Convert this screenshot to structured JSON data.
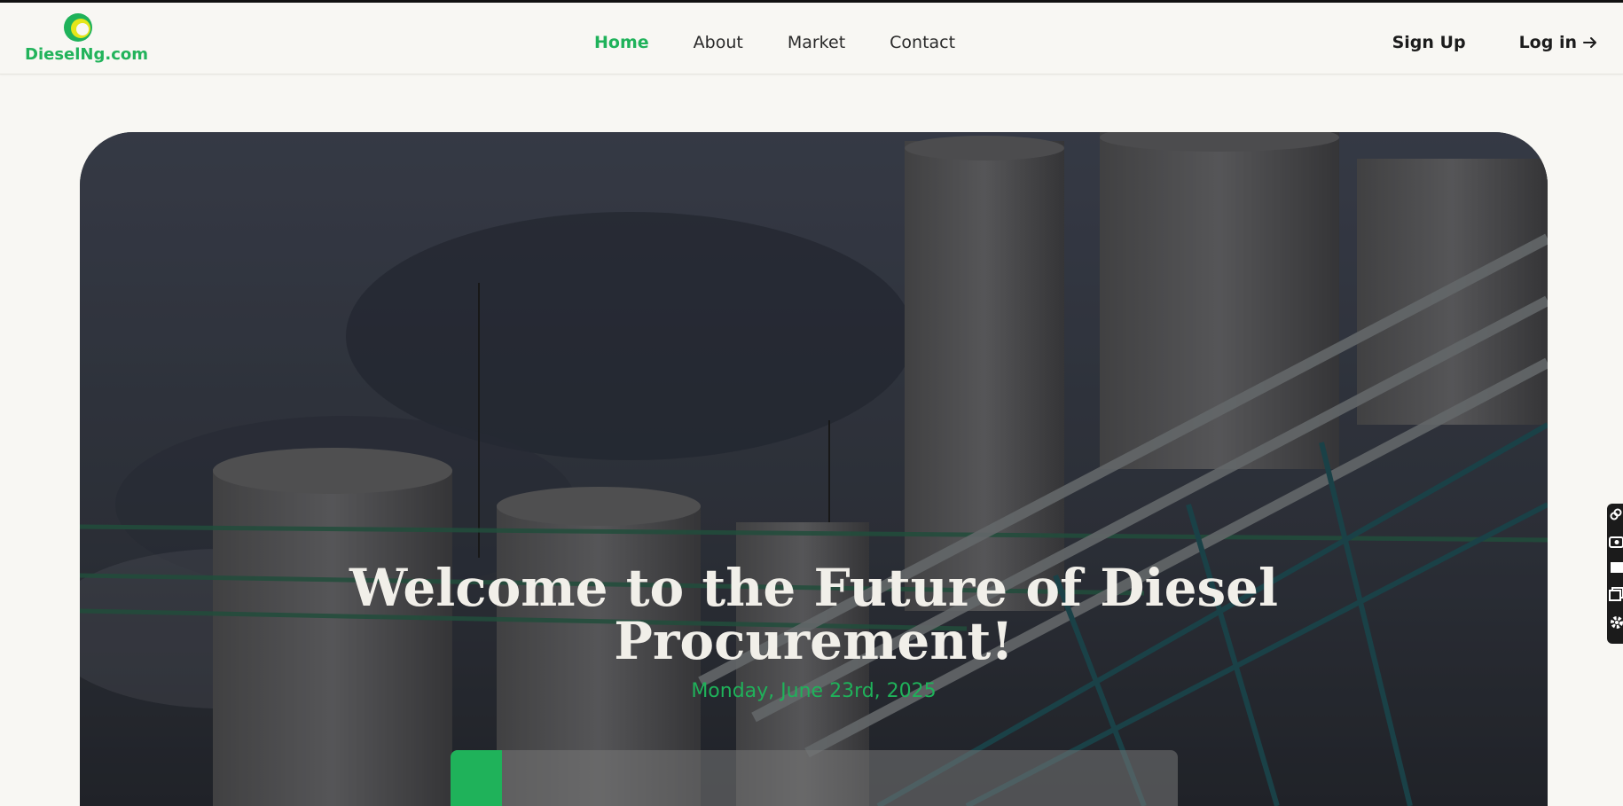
{
  "brand": {
    "name": "DieselNg.com",
    "colors": {
      "green": "#1fb25a",
      "yellow": "#e4e61a",
      "text_dark": "#1c1c1c"
    }
  },
  "nav": {
    "links": [
      {
        "label": "Home",
        "active": true
      },
      {
        "label": "About",
        "active": false
      },
      {
        "label": "Market",
        "active": false
      },
      {
        "label": "Contact",
        "active": false
      }
    ]
  },
  "auth": {
    "signup_label": "Sign Up",
    "login_label": "Log in"
  },
  "hero": {
    "title_line1": "Welcome to the Future of Diesel",
    "title_line2": "Procurement!",
    "date": "Monday, June 23rd, 2025"
  },
  "icons": {
    "logo": "logo-mark",
    "login_arrow": "arrow-right-icon",
    "side_tools": [
      "link-icon",
      "camera-icon",
      "square-icon",
      "copy-icon",
      "gear-icon"
    ]
  }
}
